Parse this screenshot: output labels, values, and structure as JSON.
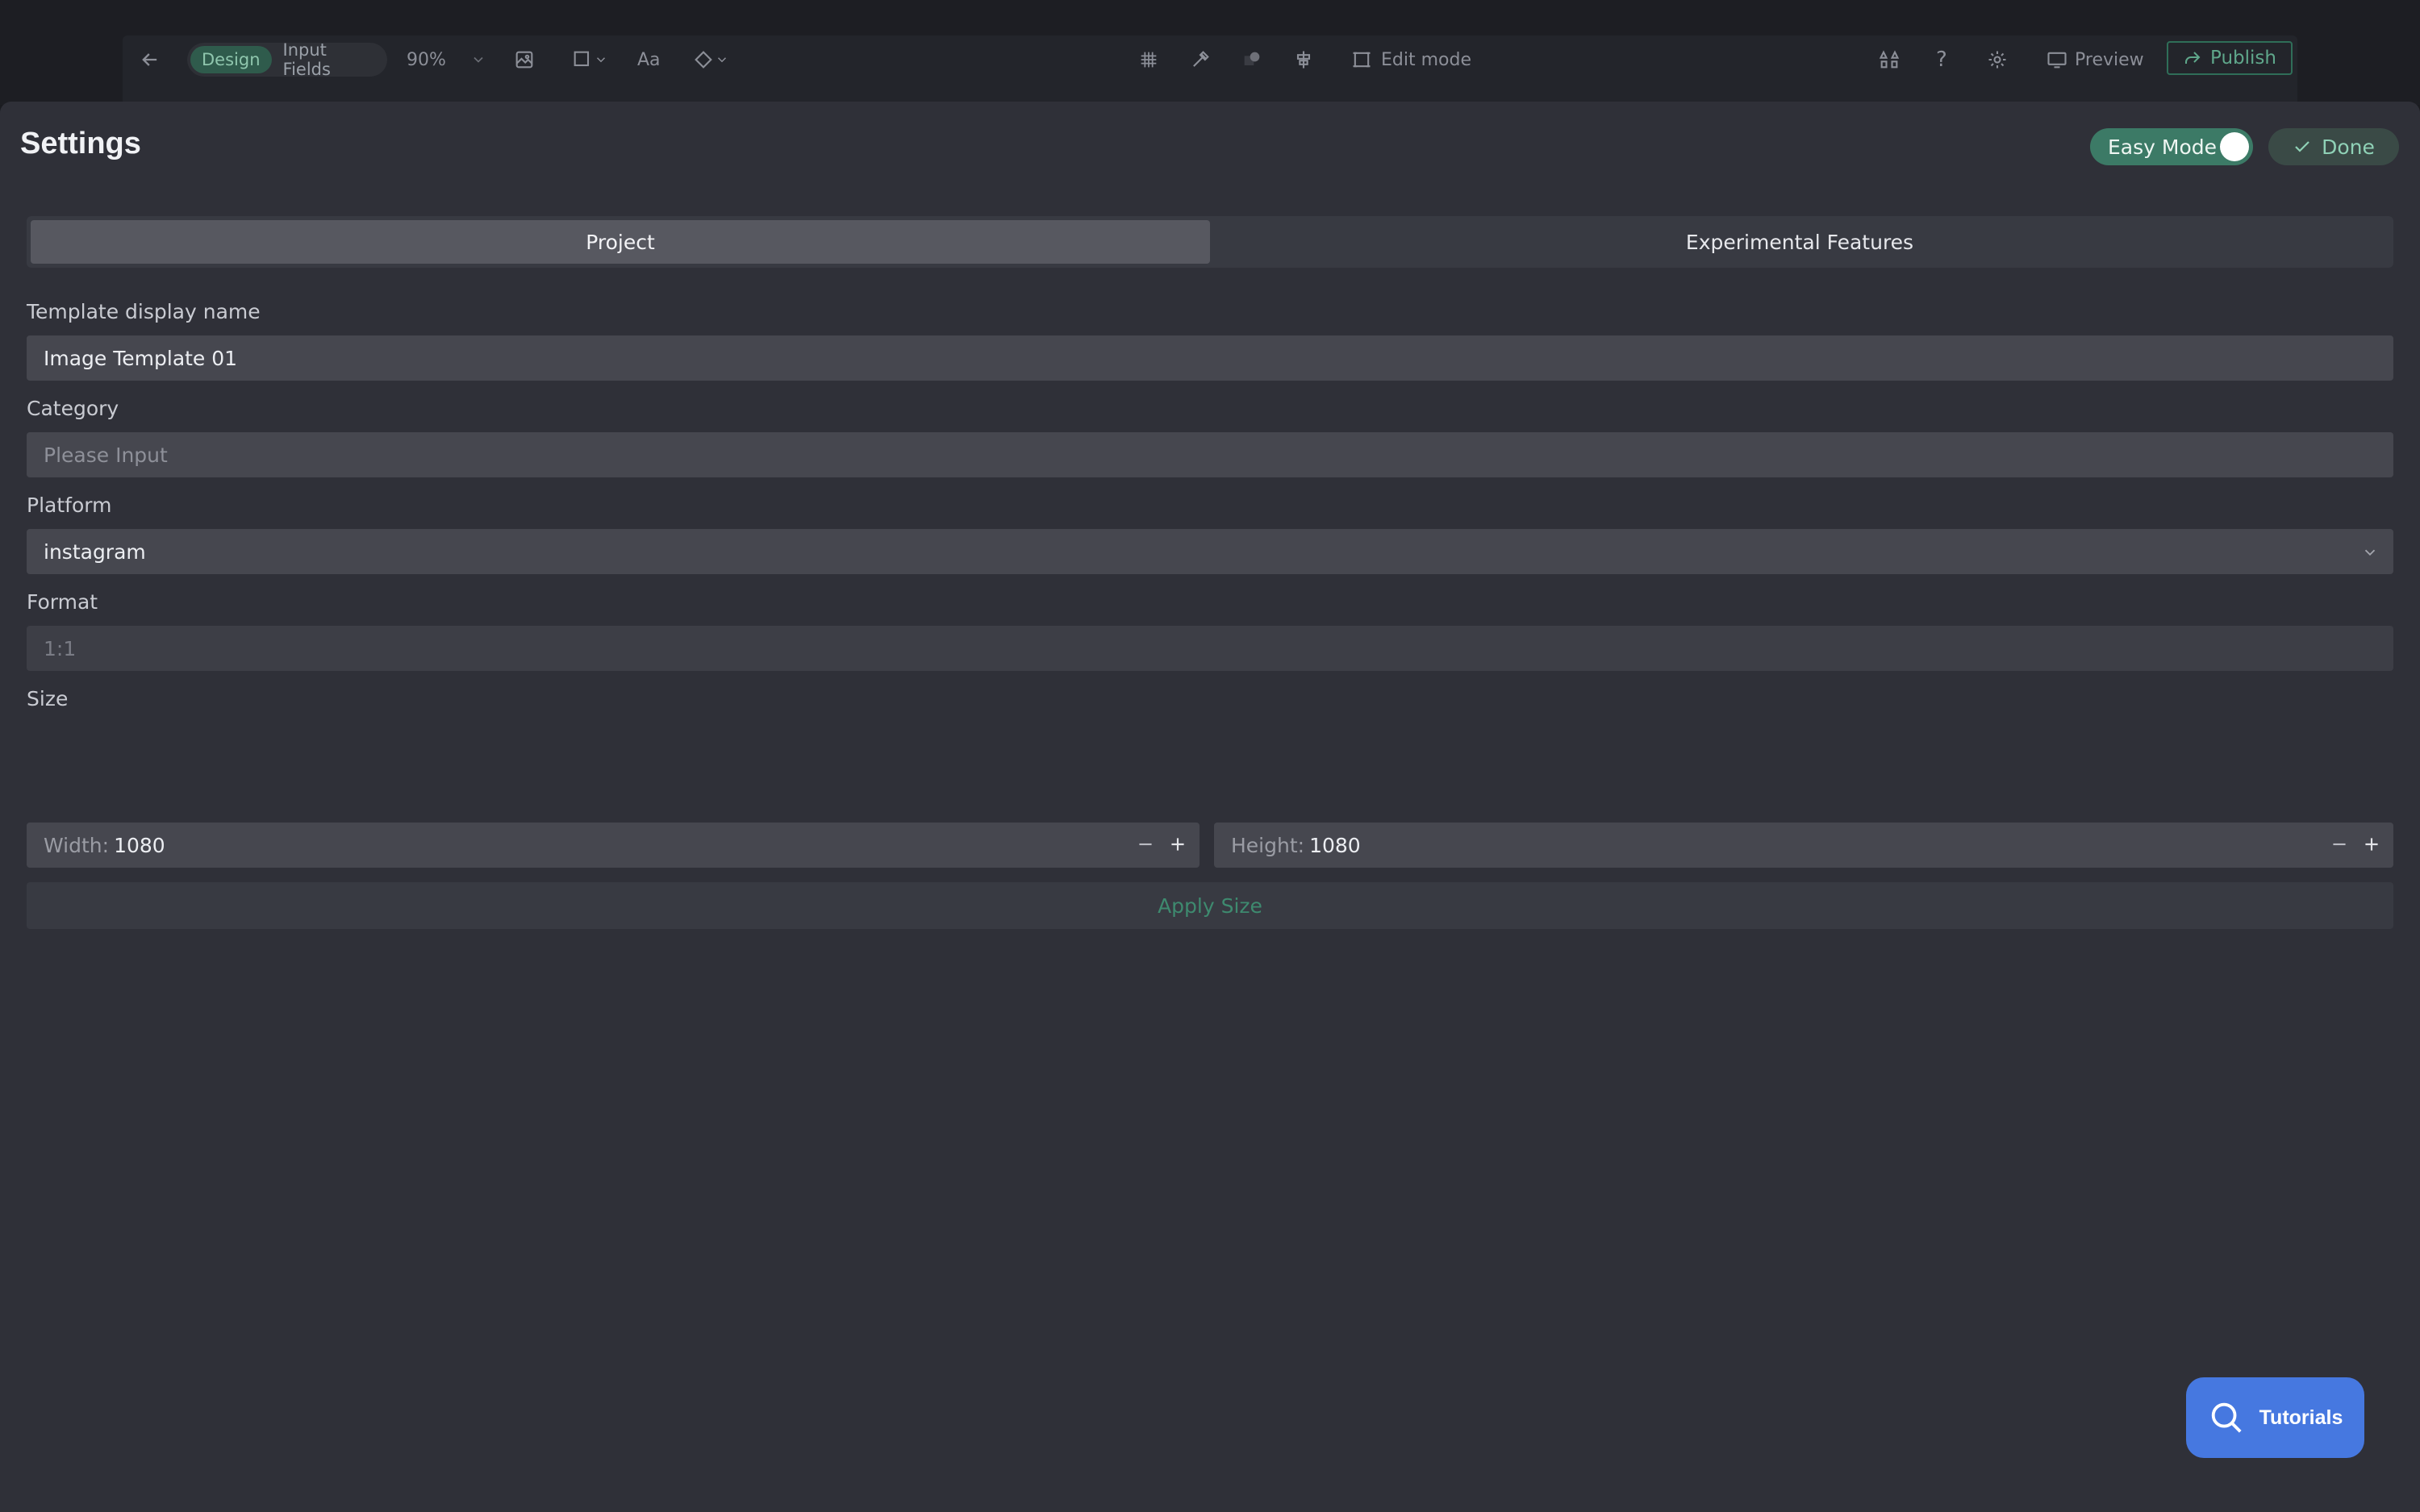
{
  "toolbar": {
    "mode_design": "Design",
    "mode_input_fields": "Input Fields",
    "zoom": "90%",
    "text_tool": "Aa",
    "edit_mode": "Edit mode",
    "help": "?",
    "preview": "Preview",
    "publish": "Publish"
  },
  "settings": {
    "title": "Settings",
    "easy_mode_label": "Easy Mode",
    "easy_mode_on": true,
    "done_label": "Done",
    "tabs": [
      {
        "label": "Project",
        "active": true
      },
      {
        "label": "Experimental Features",
        "active": false
      }
    ],
    "template_name": {
      "label": "Template display name",
      "value": "Image Template 01"
    },
    "category": {
      "label": "Category",
      "value": "",
      "placeholder": "Please Input"
    },
    "platform": {
      "label": "Platform",
      "value": "instagram"
    },
    "format": {
      "label": "Format",
      "value": "1:1"
    },
    "size": {
      "label": "Size",
      "width_prefix": "Width:",
      "width": "1080",
      "height_prefix": "Height:",
      "height": "1080"
    },
    "apply_label": "Apply Size"
  },
  "tutorials_label": "Tutorials",
  "colors": {
    "panel_bg": "#2f3038",
    "accent_green": "#3c7a66",
    "tutorials_blue": "#4678e0"
  }
}
